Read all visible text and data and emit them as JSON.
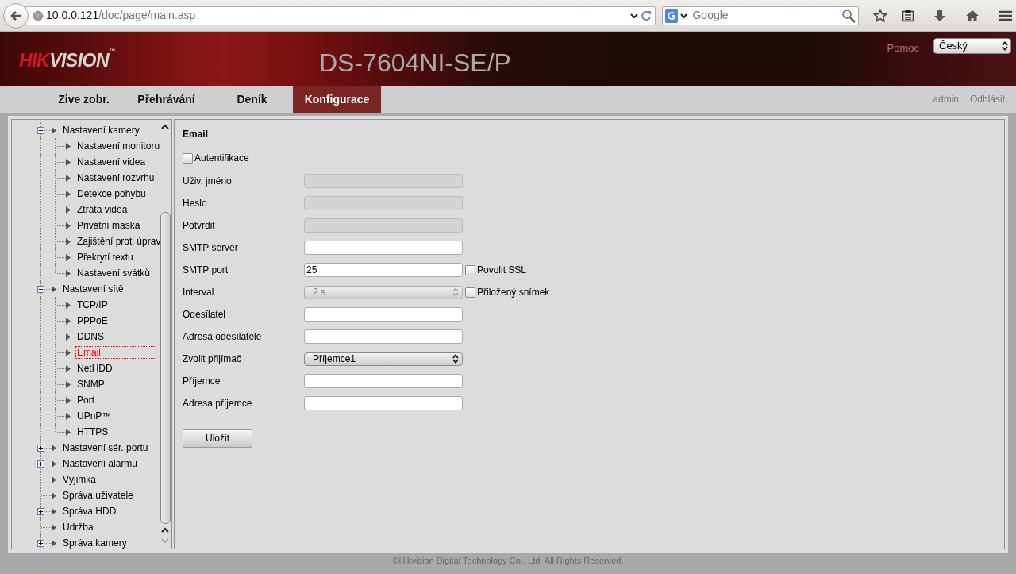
{
  "browser": {
    "url_host": "10.0.0.121",
    "url_path": "/doc/page/main.asp",
    "search_placeholder": "Google"
  },
  "header": {
    "logo_parts": [
      "HIK",
      "VISION",
      "™"
    ],
    "model": "DS-7604NI-SE/P",
    "help": "Pomoc",
    "language": "Český"
  },
  "nav": {
    "tabs": [
      {
        "label": "Zive zobr.",
        "selected": false
      },
      {
        "label": "Přehrávání",
        "selected": false
      },
      {
        "label": "Deník",
        "selected": false
      },
      {
        "label": "Konfigurace",
        "selected": true
      }
    ],
    "user": "admin",
    "logout": "Odhlásit"
  },
  "tree": [
    {
      "label": "Nastavení kamery",
      "kind": "group",
      "expanded": true,
      "selected": false,
      "children": [
        {
          "label": "Nastavení monitoru",
          "selected": false
        },
        {
          "label": "Nastavení videa",
          "selected": false
        },
        {
          "label": "Nastavení rozvrhu",
          "selected": false
        },
        {
          "label": "Detekce pohybu",
          "selected": false
        },
        {
          "label": "Ztráta videa",
          "selected": false
        },
        {
          "label": "Privátní maska",
          "selected": false
        },
        {
          "label": "Zajištění proti úprav",
          "selected": false
        },
        {
          "label": "Překrytí textu",
          "selected": false
        },
        {
          "label": "Nastavení svátků",
          "selected": false
        }
      ]
    },
    {
      "label": "Nastavení sítě",
      "kind": "group",
      "expanded": true,
      "selected": false,
      "children": [
        {
          "label": "TCP/IP",
          "selected": false
        },
        {
          "label": "PPPoE",
          "selected": false
        },
        {
          "label": "DDNS",
          "selected": false
        },
        {
          "label": "Email",
          "selected": true
        },
        {
          "label": "NetHDD",
          "selected": false
        },
        {
          "label": "SNMP",
          "selected": false
        },
        {
          "label": "Port",
          "selected": false
        },
        {
          "label": "UPnP™",
          "selected": false
        },
        {
          "label": "HTTPS",
          "selected": false
        }
      ]
    },
    {
      "label": "Nastavení sér. portu",
      "kind": "group",
      "expanded": false,
      "selected": false
    },
    {
      "label": "Nastavení alarmu",
      "kind": "group",
      "expanded": false,
      "selected": false
    },
    {
      "label": "Výjimka",
      "kind": "leaf",
      "selected": false
    },
    {
      "label": "Správa uživatele",
      "kind": "leaf",
      "selected": false
    },
    {
      "label": "Správa HDD",
      "kind": "group",
      "expanded": false,
      "selected": false
    },
    {
      "label": "Údržba",
      "kind": "leaf",
      "selected": false
    },
    {
      "label": "Správa kamery",
      "kind": "group",
      "expanded": false,
      "selected": false
    }
  ],
  "form": {
    "title": "Email",
    "auth": {
      "label": "Autentifikace",
      "checked": false
    },
    "fields": [
      {
        "label": "Uživ. jméno",
        "kind": "text",
        "disabled": true
      },
      {
        "label": "Heslo",
        "kind": "text",
        "disabled": true
      },
      {
        "label": "Potvrdit",
        "kind": "text",
        "disabled": true
      },
      {
        "label": "SMTP server",
        "kind": "text",
        "disabled": false
      },
      {
        "label": "SMTP port",
        "kind": "text",
        "disabled": false,
        "value": "25",
        "option": {
          "label": "Povolit SSL",
          "checked": false
        }
      },
      {
        "label": "Interval",
        "kind": "select",
        "disabled": true,
        "value": "2 s",
        "option": {
          "label": "Přiložený snímek",
          "checked": false
        }
      },
      {
        "label": "Odesílatel",
        "kind": "text",
        "disabled": false
      },
      {
        "label": "Adresa odesílatele",
        "kind": "text",
        "disabled": false
      },
      {
        "label": "Zvolit přijímač",
        "kind": "select",
        "disabled": false,
        "value": "Příjemce1"
      },
      {
        "label": "Příjemce",
        "kind": "text",
        "disabled": false
      },
      {
        "label": "Adresa příjemce",
        "kind": "text",
        "disabled": false
      }
    ],
    "save": "Uložit"
  },
  "footer": "©Hikvision Digital Technology Co., Ltd. All Rights Reserved."
}
